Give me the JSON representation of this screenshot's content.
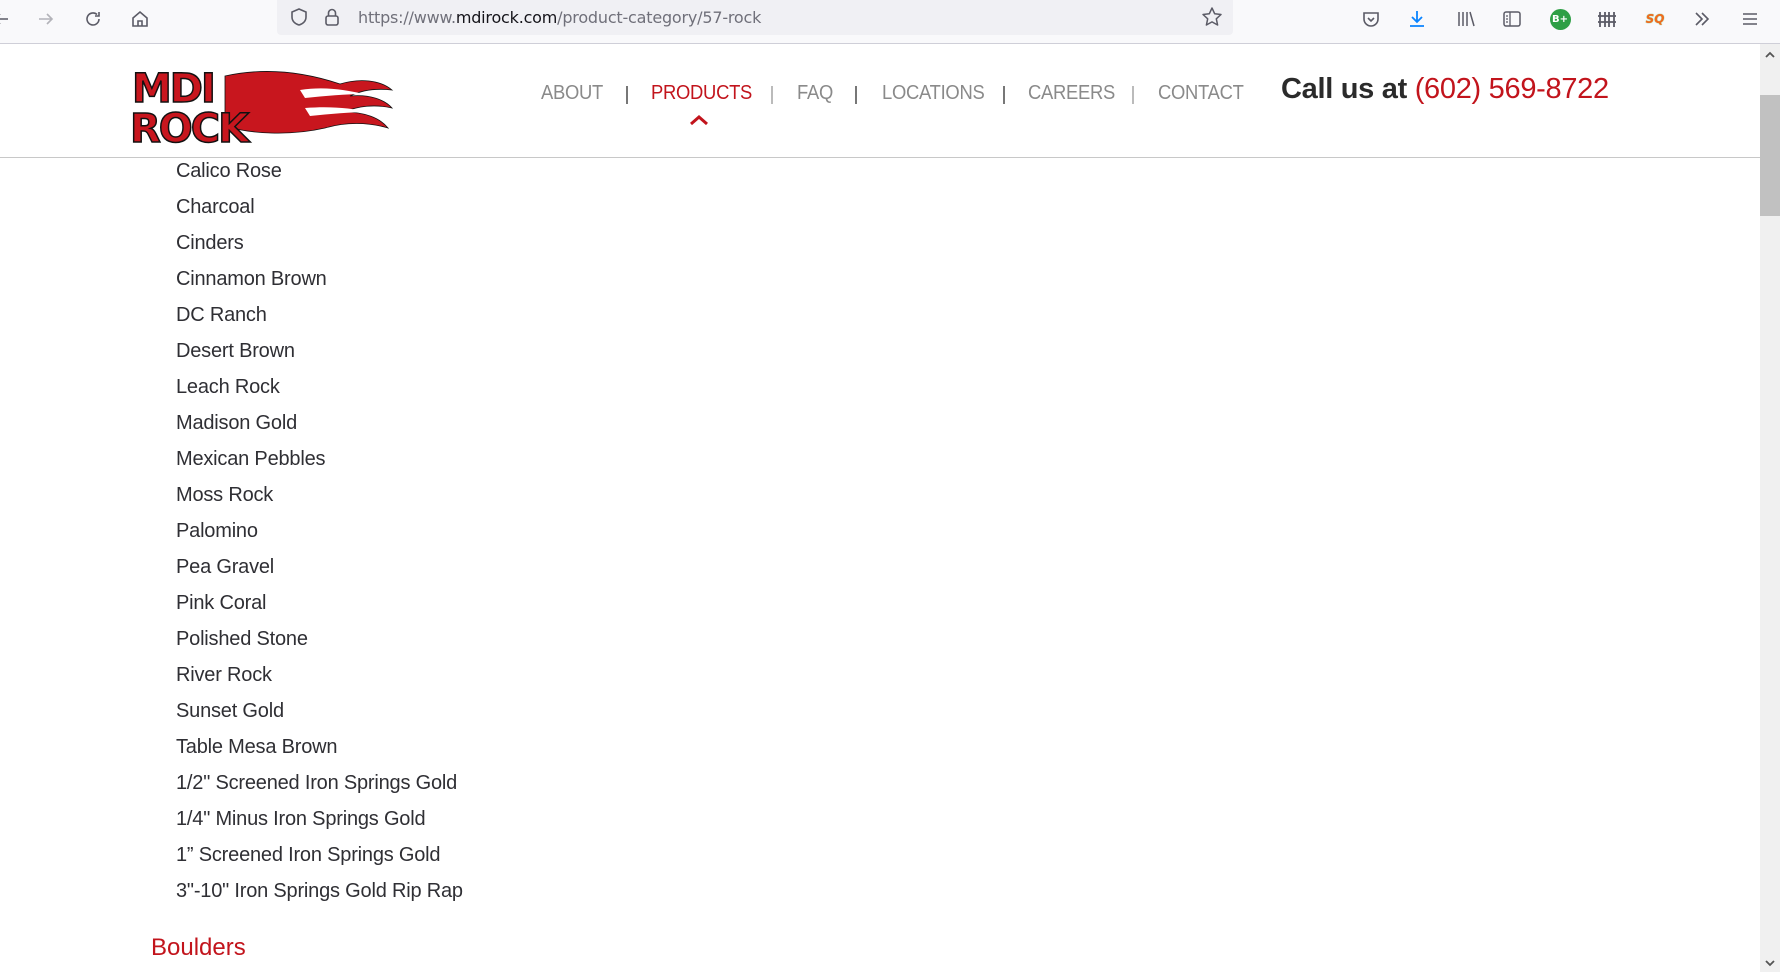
{
  "browser": {
    "url_scheme": "https://www.",
    "url_host": "mdirock.com",
    "url_path": "/product-category/57-rock",
    "toolbar_icons": [
      "back-arrow-icon",
      "forward-arrow-icon",
      "reload-icon",
      "home-icon",
      "shield-icon",
      "lock-icon",
      "bookmark-star-icon",
      "pocket-icon",
      "download-icon",
      "library-icon",
      "sidebar-icon",
      "bplus-extension-icon",
      "fence-extension-icon",
      "sq-extension-icon",
      "overflow-chevron-icon",
      "hamburger-menu-icon"
    ],
    "extension_bplus_label": "B+",
    "extension_sq_label": "SQ"
  },
  "header": {
    "logo_text": "MDI ROCK",
    "nav": [
      {
        "label": "ABOUT",
        "active": false
      },
      {
        "label": "PRODUCTS",
        "active": true
      },
      {
        "label": "FAQ",
        "active": false
      },
      {
        "label": "LOCATIONS",
        "active": false
      },
      {
        "label": "CAREERS",
        "active": false
      },
      {
        "label": "CONTACT",
        "active": false
      }
    ],
    "call_label": "Call us at",
    "phone": "(602) 569-8722"
  },
  "products": {
    "items": [
      "Calico Rose",
      "Charcoal",
      "Cinders",
      "Cinnamon Brown",
      "DC Ranch",
      "Desert Brown",
      "Leach Rock",
      "Madison Gold",
      "Mexican Pebbles",
      "Moss Rock",
      "Palomino",
      "Pea Gravel",
      "Pink Coral",
      "Polished Stone",
      "River Rock",
      "Sunset Gold",
      "Table Mesa Brown",
      "1/2\" Screened Iron Springs Gold",
      "1/4\" Minus Iron Springs Gold",
      "1” Screened Iron Springs Gold",
      "3\"-10\" Iron Springs Gold Rip Rap"
    ],
    "next_section": "Boulders"
  },
  "colors": {
    "brand_red": "#c2141c",
    "nav_gray": "#8a8a8a",
    "text_dark": "#2f2f34"
  }
}
